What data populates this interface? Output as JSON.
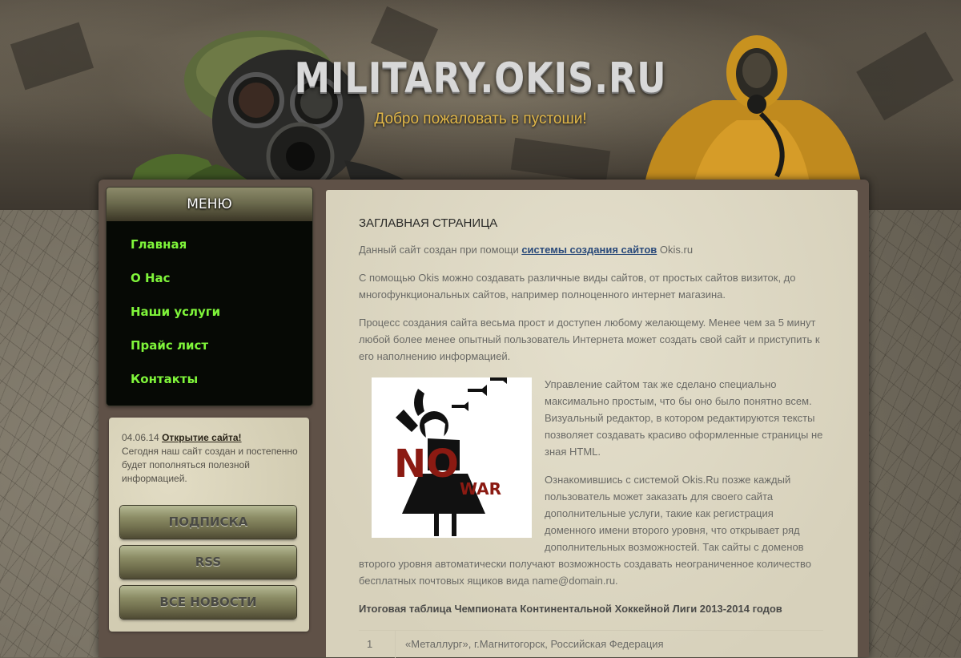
{
  "header": {
    "title": "MILITARY.OKIS.RU",
    "slogan": "Добро пожаловать в пустоши!"
  },
  "menu": {
    "heading": "МЕНЮ",
    "items": [
      {
        "label": "Главная"
      },
      {
        "label": "О Нас"
      },
      {
        "label": "Наши услуги"
      },
      {
        "label": "Прайс лист"
      },
      {
        "label": "Контакты"
      }
    ]
  },
  "news": {
    "date": "04.06.14",
    "headline": "Открытие сайта!",
    "text": "Сегодня наш сайт создан и постепенно будет пополняться полезной информацией.",
    "buttons": {
      "subscribe": "ПОДПИСКА",
      "rss": "RSS",
      "all_news": "ВСЕ НОВОСТИ"
    }
  },
  "content": {
    "page_title": "ЗАГЛАВНАЯ СТРАНИЦА",
    "p1_before": "Данный сайт создан при помощи ",
    "p1_link": "системы создания сайтов",
    "p1_after": " Okis.ru",
    "p2": "С помощью Okis можно создавать различные виды сайтов, от простых сайтов визиток, до многофункциональных сайтов, например полноценного интернет магазина.",
    "p3": "Процесс создания сайта весьма прост и доступен любому желающему. Менее чем за 5 минут любой более менее опытный пользователь Интернета может создать свой сайт и приступить к его наполнению информацией.",
    "p4": "Управление сайтом так же сделано специально максимально простым, что бы оно было понятно всем. Визуальный редактор, в котором редактируются тексты позволяет создавать красиво оформленные страницы не зная HTML.",
    "p5": "Ознакомившись с системой Okis.Ru позже каждый пользователь может заказать для своего сайта дополнительные услуги, такие как регистрация доменного имени второго уровня, что открывает ряд дополнительных возможностей. Так сайты с доменов второго уровня автоматически получают возможность создавать неограниченное количество бесплатных почтовых ящиков вида name@domain.ru.",
    "poster": {
      "no": "NO",
      "war": "WAR"
    },
    "table_caption": "Итоговая таблица Чемпионата Континентальной Хоккейной Лиги 2013-2014 годов",
    "table_rows": [
      {
        "num": "1",
        "team": "«Металлург», г.Магнитогорск, Российская Федерация"
      }
    ]
  }
}
